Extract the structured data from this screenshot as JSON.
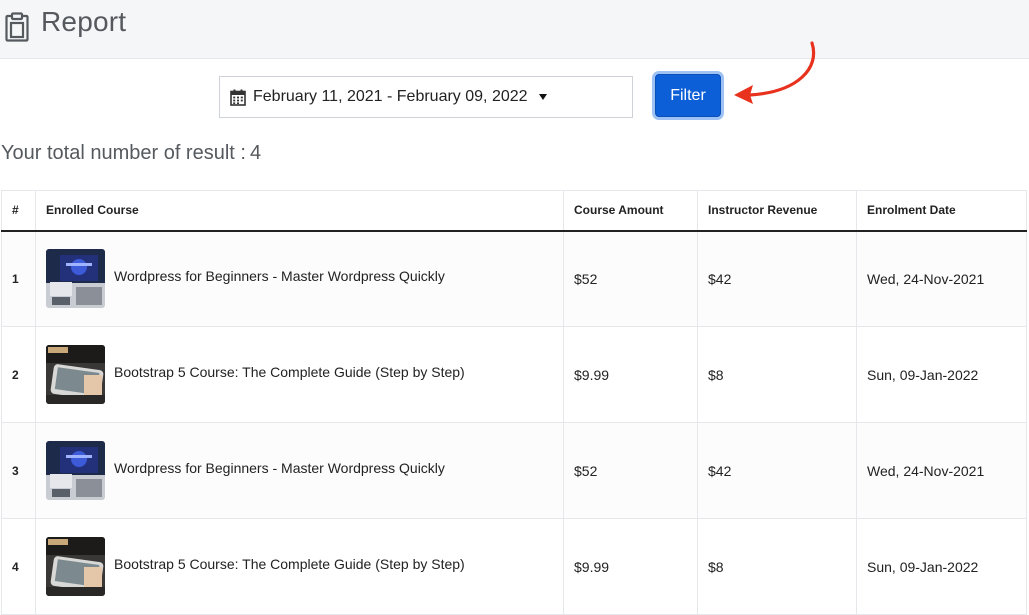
{
  "header": {
    "title": "Report",
    "icon": "clipboard-icon"
  },
  "filter": {
    "date_range": "February 11, 2021 - February 09, 2022",
    "calendar_icon": "calendar-icon",
    "button_label": "Filter",
    "button_color": "#0d5fd8"
  },
  "summary": {
    "label": "Your total number of result :",
    "count": "4"
  },
  "table": {
    "headers": [
      "#",
      "Enrolled Course",
      "Course Amount",
      "Instructor Revenue",
      "Enrolment Date"
    ],
    "rows": [
      {
        "num": "1",
        "course": "Wordpress for Beginners - Master Wordpress Quickly",
        "thumb": "wordpress-thumbnail",
        "amount": "$52",
        "revenue": "$42",
        "date": "Wed, 24-Nov-2021"
      },
      {
        "num": "2",
        "course": "Bootstrap 5 Course: The Complete Guide (Step by Step)",
        "thumb": "bootstrap-thumbnail",
        "amount": "$9.99",
        "revenue": "$8",
        "date": "Sun, 09-Jan-2022"
      },
      {
        "num": "3",
        "course": "Wordpress for Beginners - Master Wordpress Quickly",
        "thumb": "wordpress-thumbnail",
        "amount": "$52",
        "revenue": "$42",
        "date": "Wed, 24-Nov-2021"
      },
      {
        "num": "4",
        "course": "Bootstrap 5 Course: The Complete Guide (Step by Step)",
        "thumb": "bootstrap-thumbnail",
        "amount": "$9.99",
        "revenue": "$8",
        "date": "Sun, 09-Jan-2022"
      }
    ]
  },
  "annotation": {
    "arrow_color": "#e8321e"
  }
}
